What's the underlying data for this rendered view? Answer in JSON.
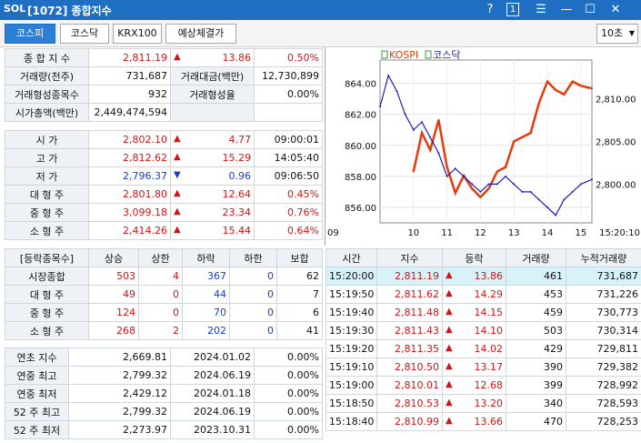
{
  "window": {
    "logo": "SOL",
    "title": "[1072] 종합지수",
    "icons": [
      "help-icon",
      "number-one-icon",
      "menu-icon",
      "minimize-icon",
      "maximize-icon",
      "close-icon"
    ],
    "icon_glyphs": [
      "?",
      "1",
      "☰",
      "—",
      "☐",
      "✕"
    ]
  },
  "toolbar": {
    "tabs": [
      "코스피",
      "코스닥",
      "KRX100",
      "예상체결가"
    ],
    "active_tab": "코스피",
    "interval_select": "10초"
  },
  "index_summary": {
    "row1": {
      "label": "종 합 지 수",
      "value": "2,811.19",
      "arrow": "▲",
      "change": "13.86",
      "pct": "0.50%"
    },
    "row2": {
      "label": "거래량(천주)",
      "value": "731,687",
      "label2": "거래대금(백만)",
      "value2": "12,730,899"
    },
    "row3": {
      "label": "거래형성종목수",
      "value": "932",
      "label2": "거래형성율",
      "value2": "0.00%"
    },
    "row4": {
      "label": "시가총액(백만)",
      "value": "2,449,474,594"
    }
  },
  "ohlc": {
    "rows": [
      {
        "label": "시 가",
        "value": "2,802.10",
        "arrow": "▲",
        "change": "4.77",
        "time": "09:00:01",
        "color": "red"
      },
      {
        "label": "고 가",
        "value": "2,812.62",
        "arrow": "▲",
        "change": "15.29",
        "time": "14:05:40",
        "color": "red"
      },
      {
        "label": "저 가",
        "value": "2,796.37",
        "arrow": "▼",
        "change": "0.96",
        "time": "09:06:50",
        "color": "blue"
      },
      {
        "label": "대 형 주",
        "value": "2,801.80",
        "arrow": "▲",
        "change": "12.64",
        "time": "0.45%",
        "color": "red"
      },
      {
        "label": "중 형 주",
        "value": "3,099.18",
        "arrow": "▲",
        "change": "23.34",
        "time": "0.76%",
        "color": "red"
      },
      {
        "label": "소 형 주",
        "value": "2,414.26",
        "arrow": "▲",
        "change": "15.44",
        "time": "0.64%",
        "color": "red"
      }
    ]
  },
  "breadth": {
    "headers": [
      "[등락종목수]",
      "상승",
      "상한",
      "하락",
      "하한",
      "보합"
    ],
    "rows": [
      {
        "label": "시장종합",
        "up": "503",
        "upper": "4",
        "down": "367",
        "lower": "0",
        "flat": "62"
      },
      {
        "label": "대 형 주",
        "up": "49",
        "upper": "0",
        "down": "44",
        "lower": "0",
        "flat": "7"
      },
      {
        "label": "중 형 주",
        "up": "124",
        "upper": "0",
        "down": "70",
        "lower": "0",
        "flat": "6"
      },
      {
        "label": "소 형 주",
        "up": "268",
        "upper": "2",
        "down": "202",
        "lower": "0",
        "flat": "41"
      }
    ]
  },
  "highs_lows": {
    "rows": [
      {
        "label": "연초 지수",
        "value": "2,669.81",
        "date": "2024.01.02",
        "pct": "0.00%"
      },
      {
        "label": "연중 최고",
        "value": "2,799.32",
        "date": "2024.06.19",
        "pct": "0.00%"
      },
      {
        "label": "연중 최저",
        "value": "2,429.12",
        "date": "2024.01.18",
        "pct": "0.00%"
      },
      {
        "label": "52 주 최고",
        "value": "2,799.32",
        "date": "2024.06.19",
        "pct": "0.00%"
      },
      {
        "label": "52 주 최저",
        "value": "2,273.97",
        "date": "2023.10.31",
        "pct": "0.00%"
      }
    ]
  },
  "ticks": {
    "headers": [
      "시간",
      "지수",
      "등락",
      "거래량",
      "누적거래량"
    ],
    "rows": [
      {
        "time": "15:20:00",
        "index": "2,811.19",
        "arrow": "▲",
        "change": "13.86",
        "vol": "461",
        "cum": "731,687"
      },
      {
        "time": "15:19:50",
        "index": "2,811.62",
        "arrow": "▲",
        "change": "14.29",
        "vol": "453",
        "cum": "731,226"
      },
      {
        "time": "15:19:40",
        "index": "2,811.48",
        "arrow": "▲",
        "change": "14.15",
        "vol": "459",
        "cum": "730,773"
      },
      {
        "time": "15:19:30",
        "index": "2,811.43",
        "arrow": "▲",
        "change": "14.10",
        "vol": "503",
        "cum": "730,314"
      },
      {
        "time": "15:19:20",
        "index": "2,811.35",
        "arrow": "▲",
        "change": "14.02",
        "vol": "429",
        "cum": "729,811"
      },
      {
        "time": "15:19:10",
        "index": "2,810.50",
        "arrow": "▲",
        "change": "13.17",
        "vol": "390",
        "cum": "729,382"
      },
      {
        "time": "15:19:00",
        "index": "2,810.01",
        "arrow": "▲",
        "change": "12.68",
        "vol": "399",
        "cum": "728,992"
      },
      {
        "time": "15:18:50",
        "index": "2,810.53",
        "arrow": "▲",
        "change": "13.20",
        "vol": "340",
        "cum": "728,593"
      },
      {
        "time": "15:18:40",
        "index": "2,810.99",
        "arrow": "▲",
        "change": "13.66",
        "vol": "470",
        "cum": "728,253"
      }
    ]
  },
  "chart_data": {
    "type": "line",
    "legend": [
      "KOSPI",
      "코스닥"
    ],
    "series": [
      {
        "name": "KOSPI",
        "color": "#e83a0a",
        "axis": "right",
        "x": [
          10.0,
          10.25,
          10.5,
          10.75,
          11.0,
          11.25,
          11.5,
          11.75,
          12.0,
          12.25,
          12.5,
          12.75,
          13.0,
          13.25,
          13.5,
          13.75,
          14.0,
          14.25,
          14.5,
          14.75,
          15.0,
          15.33
        ],
        "values": [
          2801.5,
          2806.0,
          2804.0,
          2807.5,
          2802.0,
          2799.0,
          2801.0,
          2799.5,
          2798.5,
          2799.5,
          2801.5,
          2802.0,
          2805.0,
          2805.5,
          2806.0,
          2809.5,
          2812.0,
          2811.0,
          2810.5,
          2812.0,
          2811.5,
          2811.19
        ]
      },
      {
        "name": "코스닥",
        "color": "#2020b0",
        "axis": "left",
        "x": [
          9.0,
          9.25,
          9.5,
          9.75,
          10.0,
          10.25,
          10.5,
          10.75,
          11.0,
          11.25,
          11.5,
          11.75,
          12.0,
          12.25,
          12.5,
          12.75,
          13.0,
          13.25,
          13.5,
          13.75,
          14.0,
          14.25,
          14.5,
          14.75,
          15.0,
          15.33
        ],
        "values": [
          862.5,
          864.5,
          863.5,
          862.0,
          861.0,
          861.5,
          860.5,
          859.5,
          858.0,
          858.5,
          858.0,
          857.5,
          857.0,
          857.5,
          857.5,
          858.0,
          857.5,
          857.0,
          857.0,
          856.5,
          856.0,
          855.5,
          856.5,
          857.0,
          857.5,
          857.8
        ]
      }
    ],
    "x_ticks": [
      "09",
      "10",
      "11",
      "12",
      "13",
      "14",
      "15",
      "15:20:10"
    ],
    "y_left_ticks": [
      "864.00",
      "862.00",
      "860.00",
      "858.00",
      "856.00"
    ],
    "y_left_range": [
      855,
      865.5
    ],
    "y_right_ticks": [
      "2,810.00",
      "2,805.00",
      "2,800.00"
    ],
    "y_right_range": [
      2795.5,
      2814.5
    ],
    "x_range": [
      9.0,
      15.33
    ],
    "grid": true
  }
}
